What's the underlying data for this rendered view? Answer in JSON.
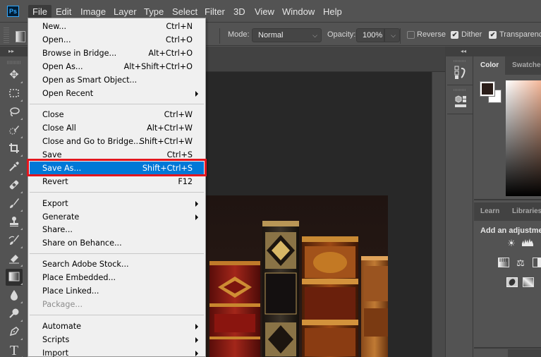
{
  "app": {
    "logo_text": "Ps"
  },
  "menubar": {
    "items": [
      "File",
      "Edit",
      "Image",
      "Layer",
      "Type",
      "Select",
      "Filter",
      "3D",
      "View",
      "Window",
      "Help"
    ],
    "active": "File"
  },
  "options_bar": {
    "mode_label": "Mode:",
    "mode_value": "Normal",
    "opacity_label": "Opacity:",
    "opacity_value": "100%",
    "reverse_label": "Reverse",
    "reverse_checked": false,
    "dither_label": "Dither",
    "dither_checked": true,
    "transparency_label": "Transparency",
    "transparency_checked": true,
    "check_glyph": "✔"
  },
  "toolbar": {
    "collapse_glyph": "▸▸",
    "tools": [
      {
        "name": "move-tool",
        "glyph": "✥"
      },
      {
        "name": "marquee-tool",
        "glyph": "⬚"
      },
      {
        "name": "lasso-tool",
        "glyph": "◯"
      },
      {
        "name": "quick-selection-tool",
        "glyph": "✎"
      },
      {
        "name": "crop-tool",
        "glyph": "⌗"
      },
      {
        "name": "eyedropper-tool",
        "glyph": "✐"
      },
      {
        "name": "healing-brush-tool",
        "glyph": "✚"
      },
      {
        "name": "brush-tool",
        "glyph": "✏"
      },
      {
        "name": "clone-stamp-tool",
        "glyph": "⊥"
      },
      {
        "name": "history-brush-tool",
        "glyph": "✎"
      },
      {
        "name": "eraser-tool",
        "glyph": "⌫"
      },
      {
        "name": "gradient-tool",
        "glyph": "▦",
        "active": true
      },
      {
        "name": "blur-tool",
        "glyph": "●"
      },
      {
        "name": "dodge-tool",
        "glyph": "⚲"
      },
      {
        "name": "pen-tool",
        "glyph": "✒"
      },
      {
        "name": "type-tool",
        "glyph": "T"
      }
    ]
  },
  "file_menu": {
    "items": [
      {
        "label": "New...",
        "shortcut": "Ctrl+N"
      },
      {
        "label": "Open...",
        "shortcut": "Ctrl+O"
      },
      {
        "label": "Browse in Bridge...",
        "shortcut": "Alt+Ctrl+O"
      },
      {
        "label": "Open As...",
        "shortcut": "Alt+Shift+Ctrl+O"
      },
      {
        "label": "Open as Smart Object...",
        "shortcut": ""
      },
      {
        "label": "Open Recent",
        "shortcut": "",
        "submenu": true
      },
      {
        "label": "Close",
        "shortcut": "Ctrl+W"
      },
      {
        "label": "Close All",
        "shortcut": "Alt+Ctrl+W"
      },
      {
        "label": "Close and Go to Bridge...",
        "shortcut": "Shift+Ctrl+W"
      },
      {
        "label": "Save",
        "shortcut": "Ctrl+S"
      },
      {
        "label": "Save As...",
        "shortcut": "Shift+Ctrl+S",
        "highlighted": true
      },
      {
        "label": "Revert",
        "shortcut": "F12"
      },
      {
        "label": "Export",
        "shortcut": "",
        "submenu": true
      },
      {
        "label": "Generate",
        "shortcut": "",
        "submenu": true
      },
      {
        "label": "Share...",
        "shortcut": ""
      },
      {
        "label": "Share on Behance...",
        "shortcut": ""
      },
      {
        "label": "Search Adobe Stock...",
        "shortcut": ""
      },
      {
        "label": "Place Embedded...",
        "shortcut": ""
      },
      {
        "label": "Place Linked...",
        "shortcut": ""
      },
      {
        "label": "Package...",
        "shortcut": "",
        "disabled": true
      },
      {
        "label": "Automate",
        "shortcut": "",
        "submenu": true
      },
      {
        "label": "Scripts",
        "shortcut": "",
        "submenu": true
      },
      {
        "label": "Import",
        "shortcut": "",
        "submenu": true
      }
    ]
  },
  "right_dock": {
    "collapse_glyph": "◂◂",
    "buttons": [
      {
        "name": "history-panel-button",
        "glyph": "⤴"
      },
      {
        "name": "3d-panel-button",
        "glyph": "⬡"
      }
    ]
  },
  "color_panel": {
    "tabs": [
      "Color",
      "Swatches"
    ],
    "active_tab": "Color",
    "foreground_color": "#2b1e19",
    "background_color": "#ffffff"
  },
  "adjustments_panel": {
    "tabs": [
      "Learn",
      "Libraries"
    ],
    "title": "Add an adjustment",
    "icons": [
      {
        "name": "brightness-contrast-icon",
        "glyph": "☀"
      },
      {
        "name": "levels-icon",
        "glyph": "▟"
      },
      {
        "name": "hue-saturation-icon",
        "glyph": "▤"
      },
      {
        "name": "color-balance-icon",
        "glyph": "⚖"
      },
      {
        "name": "black-white-icon",
        "glyph": "◧"
      },
      {
        "name": "invert-icon",
        "glyph": "◩"
      },
      {
        "name": "gradient-map-icon",
        "glyph": "▨"
      }
    ]
  },
  "accent": {
    "highlight": "#0078d7",
    "annotation_box": "#e3161e"
  }
}
